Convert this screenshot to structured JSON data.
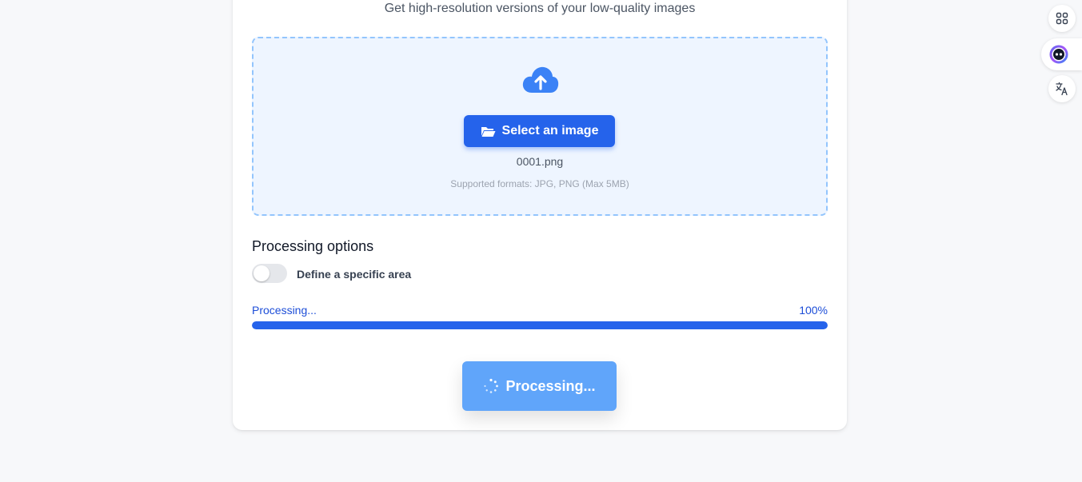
{
  "header": {
    "subtitle": "Get high-resolution versions of your low-quality images"
  },
  "upload": {
    "icon": "cloud-upload-icon",
    "select_button_label": "Select an image",
    "select_button_icon": "folder-open-icon",
    "filename": "0001.png",
    "supported_formats": "Supported formats: JPG, PNG (Max 5MB)"
  },
  "options": {
    "title": "Processing options",
    "toggle_label": "Define a specific area",
    "toggle_on": false
  },
  "progress": {
    "label": "Processing...",
    "percent_text": "100%",
    "value": 1.0
  },
  "action": {
    "button_label": "Processing...",
    "icon": "spinner-icon"
  },
  "side_toolbar": {
    "items": [
      "apps-grid-icon",
      "assistant-bot-icon",
      "translate-icon"
    ]
  },
  "colors": {
    "accent": "#2563eb",
    "accent_light": "#60a5fa",
    "dropzone_bg": "#eef5ff",
    "dropzone_border": "#93c5fd"
  }
}
